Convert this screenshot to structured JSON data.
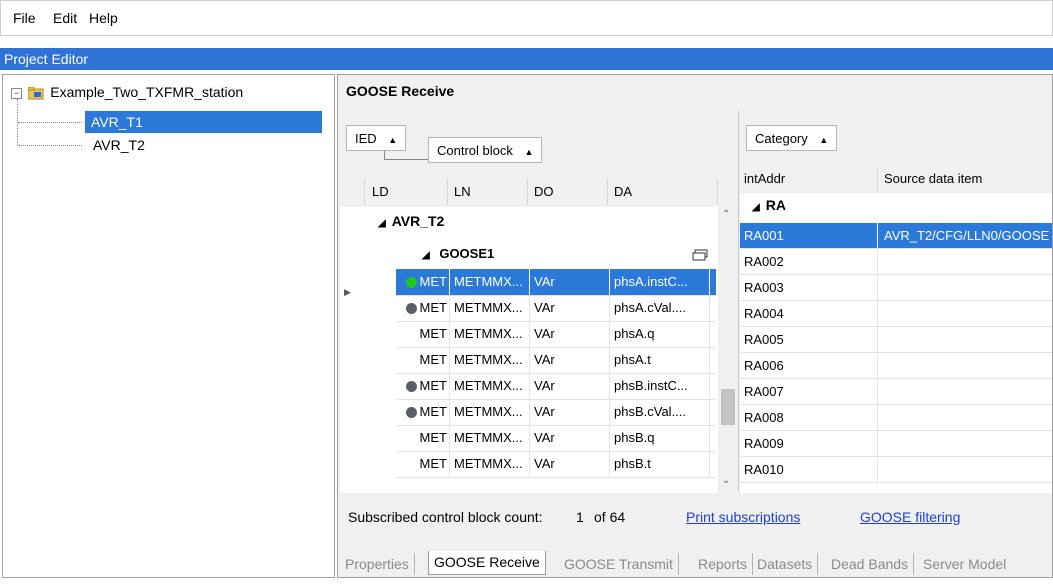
{
  "menu": {
    "file": "File",
    "edit": "Edit",
    "help": "Help"
  },
  "project_editor": {
    "title": "Project Editor"
  },
  "tree": {
    "root": "Example_Two_TXFMR_station",
    "children": [
      {
        "label": "AVR_T1",
        "selected": true
      },
      {
        "label": "AVR_T2",
        "selected": false
      }
    ]
  },
  "goose_receive": {
    "title": "GOOSE Receive",
    "group_chips": {
      "ied": "IED",
      "control_block": "Control block",
      "category": "Category"
    },
    "columns_left": {
      "ld": "LD",
      "ln": "LN",
      "do": "DO",
      "da": "DA"
    },
    "group_ied": "AVR_T2",
    "group_cb": "GOOSE1",
    "rows": [
      {
        "ld": "MET",
        "ln": "METMMX...",
        "do": "VAr",
        "da": "phsA.instC...",
        "dot": "green",
        "selected": true
      },
      {
        "ld": "MET",
        "ln": "METMMX...",
        "do": "VAr",
        "da": "phsA.cVal....",
        "dot": "gray"
      },
      {
        "ld": "MET",
        "ln": "METMMX...",
        "do": "VAr",
        "da": "phsA.q",
        "dot": "none"
      },
      {
        "ld": "MET",
        "ln": "METMMX...",
        "do": "VAr",
        "da": "phsA.t",
        "dot": "none"
      },
      {
        "ld": "MET",
        "ln": "METMMX...",
        "do": "VAr",
        "da": "phsB.instC...",
        "dot": "gray"
      },
      {
        "ld": "MET",
        "ln": "METMMX...",
        "do": "VAr",
        "da": "phsB.cVal....",
        "dot": "gray"
      },
      {
        "ld": "MET",
        "ln": "METMMX...",
        "do": "VAr",
        "da": "phsB.q",
        "dot": "none"
      },
      {
        "ld": "MET",
        "ln": "METMMX...",
        "do": "VAr",
        "da": "phsB.t",
        "dot": "none"
      }
    ],
    "columns_right": {
      "intaddr": "intAddr",
      "source": "Source data item"
    },
    "group_category": "RA",
    "right_rows": [
      {
        "addr": "RA001",
        "source": "AVR_T2/CFG/LLN0/GOOSE",
        "selected": true
      },
      {
        "addr": "RA002",
        "source": ""
      },
      {
        "addr": "RA003",
        "source": ""
      },
      {
        "addr": "RA004",
        "source": ""
      },
      {
        "addr": "RA005",
        "source": ""
      },
      {
        "addr": "RA006",
        "source": ""
      },
      {
        "addr": "RA007",
        "source": ""
      },
      {
        "addr": "RA008",
        "source": ""
      },
      {
        "addr": "RA009",
        "source": ""
      },
      {
        "addr": "RA010",
        "source": ""
      }
    ],
    "subscribed_label": "Subscribed control block count:",
    "subscribed_count": "1",
    "subscribed_of": "of 64",
    "print_link": "Print subscriptions",
    "filter_link": "GOOSE filtering"
  },
  "tabs": [
    "Properties",
    "GOOSE Receive",
    "GOOSE Transmit",
    "Reports",
    "Datasets",
    "Dead Bands",
    "Server Model"
  ],
  "active_tab": "GOOSE Receive",
  "colors": {
    "selection": "#2b7ad9",
    "title_bar": "#2f73d6",
    "link": "#1f3fcf",
    "dot_green": "#22c522",
    "dot_gray": "#5a5f66"
  }
}
